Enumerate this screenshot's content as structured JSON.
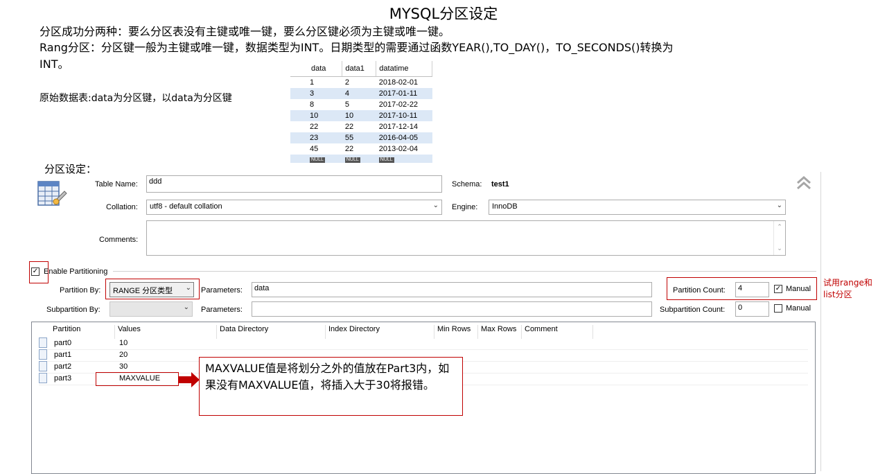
{
  "slide": {
    "title": "MYSQL分区设定",
    "line1": "分区成功分两种：要么分区表没有主键或唯一键，要么分区键必须为主键或唯一键。",
    "line2": "Rang分区：分区键一般为主键或唯一键，数据类型为INT。日期类型的需要通过函数YEAR(),TO_DAY()，TO_SECONDS()转换为",
    "line3": "INT。",
    "orig_note": "原始数据表:data为分区键，以data为分区键",
    "section_label": "分区设定：",
    "callout": "MAXVALUE值是将划分之外的值放在Part3内，如果没有MAXVALUE值，将插入大于30将报错。",
    "side_note": "试用range和list分区"
  },
  "sample_table": {
    "headers": [
      "data",
      "data1",
      "datatime"
    ],
    "rows": [
      [
        "1",
        "2",
        "2018-02-01"
      ],
      [
        "3",
        "4",
        "2017-01-11"
      ],
      [
        "8",
        "5",
        "2017-02-22"
      ],
      [
        "10",
        "10",
        "2017-10-11"
      ],
      [
        "22",
        "22",
        "2017-12-14"
      ],
      [
        "23",
        "55",
        "2016-04-05"
      ],
      [
        "45",
        "22",
        "2013-02-04"
      ]
    ],
    "null_label": "NULL"
  },
  "form": {
    "table_name_label": "Table Name:",
    "table_name_value": "ddd",
    "schema_label": "Schema:",
    "schema_value": "test1",
    "collation_label": "Collation:",
    "collation_value": "utf8 - default collation",
    "engine_label": "Engine:",
    "engine_value": "InnoDB",
    "comments_label": "Comments:",
    "enable_partitioning_label": "Enable Partitioning",
    "partition_by_label": "Partition By:",
    "partition_by_value": "RANGE  分区类型",
    "parameters_label": "Parameters:",
    "parameters_value": "data",
    "partition_count_label": "Partition Count:",
    "partition_count_value": "4",
    "manual_label": "Manual",
    "subpartition_by_label": "Subpartition By:",
    "sub_parameters_label": "Parameters:",
    "subpartition_count_label": "Subpartition Count:",
    "subpartition_count_value": "0",
    "sub_manual_label": "Manual"
  },
  "grid": {
    "columns": [
      "Partition",
      "Values",
      "Data Directory",
      "Index Directory",
      "Min Rows",
      "Max Rows",
      "Comment"
    ],
    "rows": [
      {
        "name": "part0",
        "value": "10"
      },
      {
        "name": "part1",
        "value": "20"
      },
      {
        "name": "part2",
        "value": "30"
      },
      {
        "name": "part3",
        "value": "MAXVALUE"
      }
    ]
  },
  "colors": {
    "accent_red": "#c00000",
    "row_alt": "#dce8f6"
  }
}
